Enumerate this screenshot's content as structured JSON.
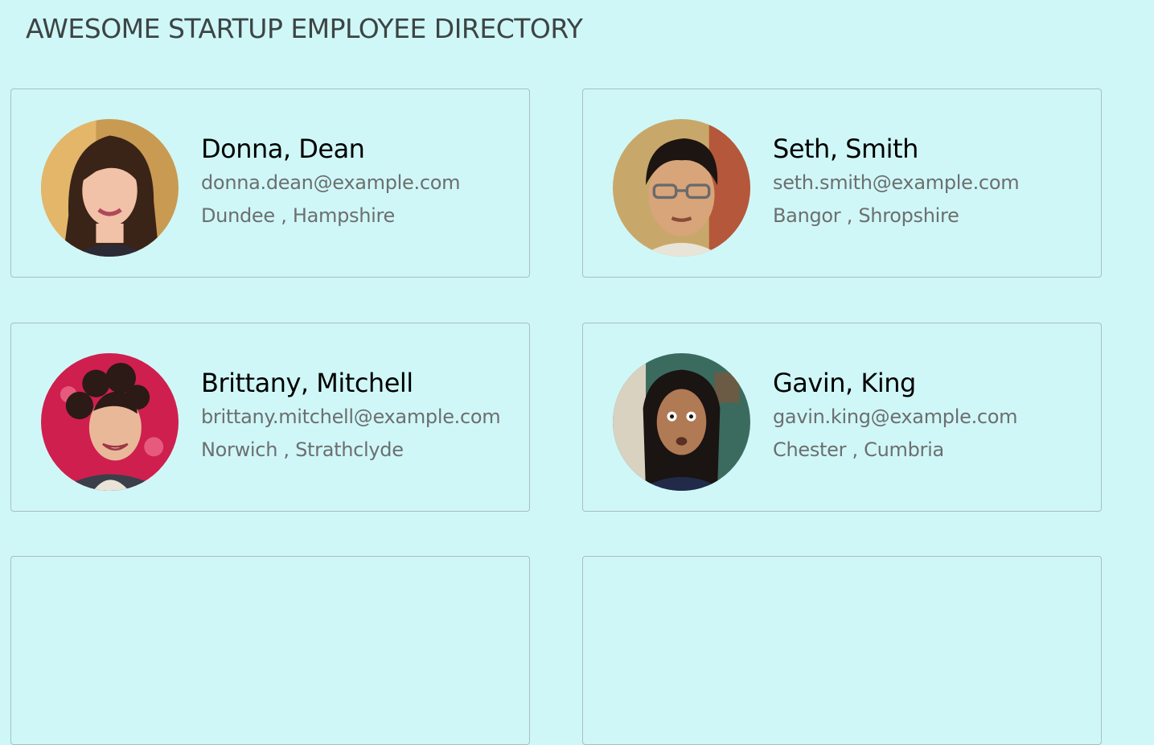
{
  "header": {
    "title": "AWESOME STARTUP EMPLOYEE DIRECTORY"
  },
  "employees": [
    {
      "name": "Donna, Dean",
      "email": "donna.dean@example.com",
      "location": "Dundee , Hampshire",
      "avatar_icon": "portrait-woman-icon",
      "avatar_bg": "#8a6a3a"
    },
    {
      "name": "Seth, Smith",
      "email": "seth.smith@example.com",
      "location": "Bangor , Shropshire",
      "avatar_icon": "portrait-man-glasses-icon",
      "avatar_bg": "#b59a6a"
    },
    {
      "name": "Brittany, Mitchell",
      "email": "brittany.mitchell@example.com",
      "location": "Norwich , Strathclyde",
      "avatar_icon": "portrait-woman-curly-icon",
      "avatar_bg": "#cf1f4e"
    },
    {
      "name": "Gavin, King",
      "email": "gavin.king@example.com",
      "location": "Chester , Cumbria",
      "avatar_icon": "portrait-man-dreadlocks-icon",
      "avatar_bg": "#3b6b5e"
    }
  ]
}
